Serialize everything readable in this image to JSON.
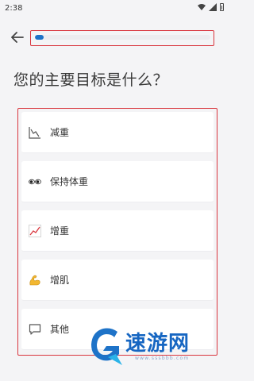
{
  "status_bar": {
    "time": "2:38"
  },
  "progress": {
    "fraction": 0.05
  },
  "title": "您的主要目标是什么？",
  "options": [
    {
      "label": "减重",
      "icon": "chart-down-icon"
    },
    {
      "label": "保持体重",
      "icon": "eyes-icon"
    },
    {
      "label": "增重",
      "icon": "chart-up-icon"
    },
    {
      "label": "增肌",
      "icon": "flexed-bicep-icon"
    },
    {
      "label": "其他",
      "icon": "speech-bubble-icon"
    }
  ],
  "watermark": {
    "text": "速游网",
    "subtext": "www.sssbbb.com"
  },
  "colors": {
    "accent": "#1e73c8",
    "highlight_border": "#d9363e"
  }
}
